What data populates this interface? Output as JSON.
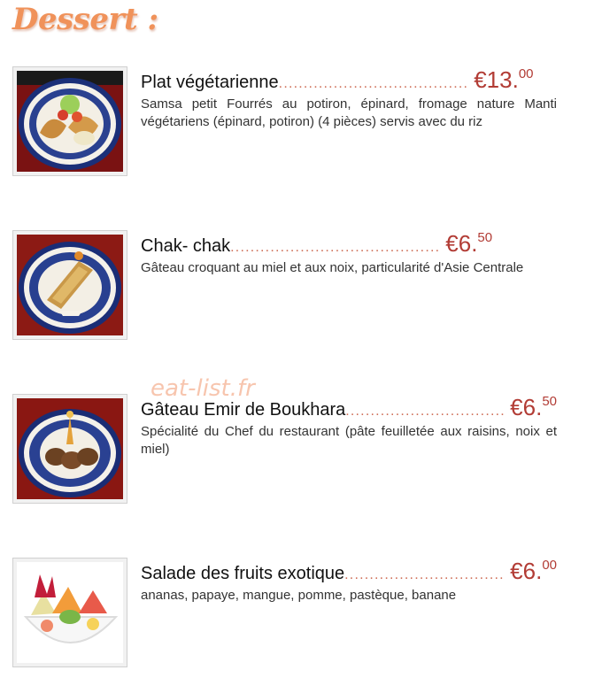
{
  "section": {
    "title": "Dessert :"
  },
  "watermark": "eat-list.fr",
  "colors": {
    "title": "#f0925a",
    "price": "#b23c35",
    "dots": "#cf6f58"
  },
  "items": [
    {
      "name": "Plat végétarienne",
      "dots": "......................................",
      "currency": "€",
      "price_main": "13.",
      "price_cents": "00",
      "description": "Samsa petit Fourrés au potiron, épinard, fromage nature Manti végétariens (épinard, potiron) (4 pièces) servis avec du riz",
      "image": "vegetarian-plate-photo"
    },
    {
      "name": "Chak- chak",
      "dots": "..........................................",
      "currency": "€",
      "price_main": "6.",
      "price_cents": "50",
      "description": "Gâteau croquant au miel et aux noix, particularité d'Asie Centrale",
      "image": "chak-chak-photo"
    },
    {
      "name": "Gâteau Emir de Boukhara",
      "dots": "........................................",
      "currency": "€",
      "price_main": "6.",
      "price_cents": "50",
      "description": "Spécialité du Chef du restaurant (pâte feuilletée aux raisins, noix et miel)",
      "image": "emir-cake-photo"
    },
    {
      "name": "Salade des fruits exotique",
      "dots": "........................................",
      "currency": "€",
      "price_main": "6.",
      "price_cents": "00",
      "description": "ananas, papaye, mangue, pomme, pastèque, banane",
      "image": "fruit-salad-photo"
    }
  ]
}
